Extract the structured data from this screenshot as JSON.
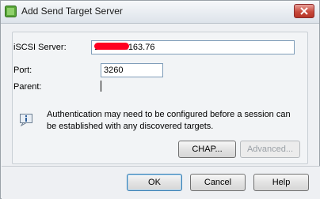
{
  "window": {
    "title": "Add Send Target Server"
  },
  "form": {
    "iscsi_server_label": "iSCSI Server:",
    "iscsi_server_value": "192.168.163.76",
    "port_label": "Port:",
    "port_value": "3260",
    "parent_label": "Parent:"
  },
  "info": {
    "message": "Authentication may need to be configured before a session can be established with any discovered targets."
  },
  "buttons": {
    "chap": "CHAP...",
    "advanced": "Advanced...",
    "ok": "OK",
    "cancel": "Cancel",
    "help": "Help"
  }
}
